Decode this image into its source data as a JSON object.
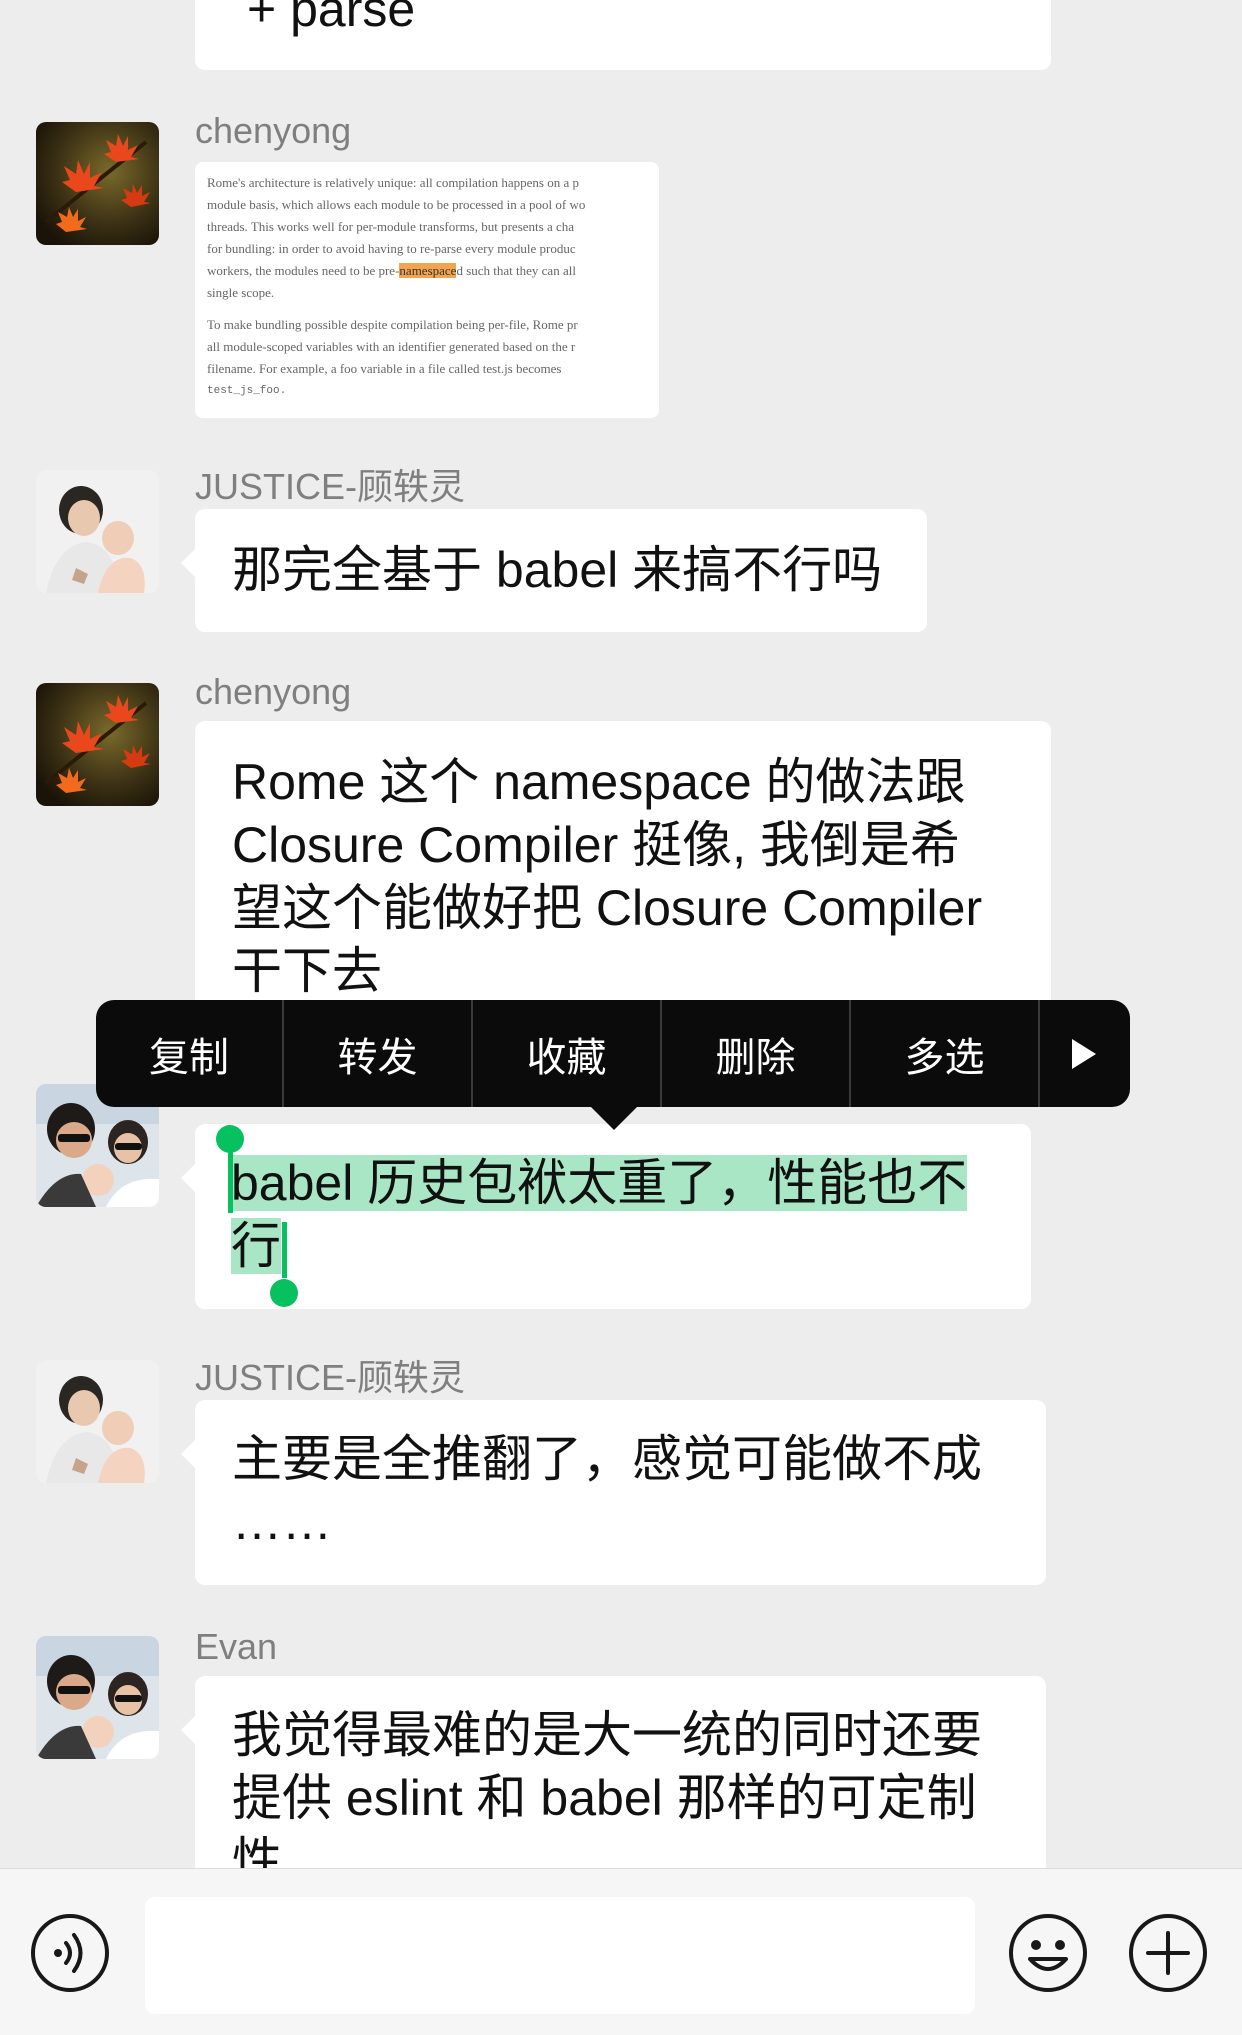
{
  "messages": [
    {
      "text": "+ parse"
    },
    {
      "sender": "chenyong",
      "image": {
        "lines": [
          "Rome's architecture is relatively unique: all compilation happens on a p",
          "module basis, which allows each module to be processed in a pool of wo",
          "threads. This works well for per-module transforms, but presents a cha",
          "for bundling: in order to avoid having to re-parse every module produc",
          "workers, the modules need to be pre-",
          "single scope.",
          "To make bundling possible despite compilation being per-file, Rome pr",
          "all module-scoped variables with an identifier generated based on the r",
          "filename. For example, a foo variable in a file called test.js becomes",
          "test_js_foo."
        ],
        "highlight": "namespace",
        "after_highlight": "d such that they can all"
      }
    },
    {
      "sender": "JUSTICE-顾轶灵",
      "text": "那完全基于 babel 来搞不行吗"
    },
    {
      "sender": "chenyong",
      "lines": [
        "Rome 这个 namespace 的做法跟",
        "Closure Compiler 挺像, 我倒是希",
        "望这个能做好把 Closure Compiler",
        "干下去"
      ]
    },
    {
      "lines": [
        "babel 历史包袱太重了，性能也不",
        "行"
      ]
    },
    {
      "sender": "JUSTICE-顾轶灵",
      "lines": [
        "主要是全推翻了，感觉可能做不成",
        "……"
      ]
    },
    {
      "sender": "Evan",
      "lines": [
        "我觉得最难的是大一统的同时还要",
        "提供 eslint 和 babel 那样的可定制",
        "性"
      ]
    }
  ],
  "context_menu": {
    "items": [
      "复制",
      "转发",
      "收藏",
      "删除",
      "多选"
    ],
    "more_icon": "play-arrow-icon"
  },
  "input_bar": {
    "voice_icon": "voice-icon",
    "emoji_icon": "emoji-icon",
    "plus_icon": "plus-icon"
  },
  "colors": {
    "background": "#ededed",
    "bubble": "#ffffff",
    "menu": "#0b0b0b",
    "selection": "#a9e6c6",
    "handle": "#07c160"
  }
}
